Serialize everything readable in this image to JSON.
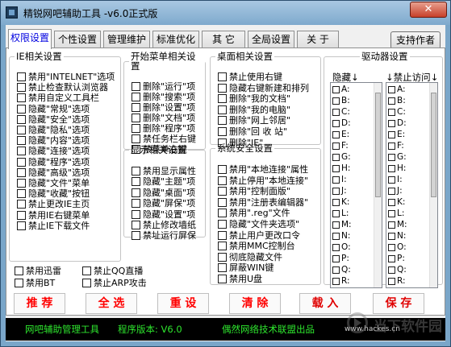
{
  "window": {
    "title": "精锐网吧辅助工具   -v6.0正式版",
    "close_glyph": "✕"
  },
  "tabs": [
    "权限设置",
    "个性设置",
    "管理维护",
    "标准优化",
    "其 它",
    "全局设置",
    "关 于"
  ],
  "support_button": "支持作者",
  "ie_group": {
    "title": "IE相关设置",
    "items": [
      "禁用\"INTELNET\"选项",
      "禁止检查默认浏览器",
      "禁用自定义工具栏",
      "隐藏\"常规\"选项",
      "隐藏\"安全\"选项",
      "隐藏\"隐私\"选项",
      "隐藏\"内容\"选项",
      "隐藏\"连接\"选项",
      "隐藏\"程序\"选项",
      "隐藏\"高级\"选项",
      "隐藏\"文件\"菜单",
      "隐藏\"收藏\"按钮",
      "禁止更改IE主页",
      "禁用IE右键菜单",
      "禁止IE下载文件"
    ]
  },
  "misc_items": [
    "禁用迅雷",
    "禁用BT",
    "禁止QQ直播",
    "禁止ARP攻击"
  ],
  "start_group": {
    "title": "开始菜单相关设置",
    "items": [
      "删除\"运行\"项",
      "删除\"搜索\"项",
      "删除\"设置\"项",
      "删除\"文档\"项",
      "删除\"程序\"项",
      "禁任务栏右键",
      "禁菜单右键"
    ]
  },
  "display_group": {
    "title": "显示相关设置",
    "items": [
      "禁用显示属性",
      "隐藏\"主题\"项",
      "隐藏\"桌面\"项",
      "隐藏\"屏保\"项",
      "隐藏\"设置\"项",
      "禁止修改墙纸",
      "禁址运行屏保"
    ]
  },
  "desktop_group": {
    "title": "桌面相关设置",
    "items": [
      "禁止使用右键",
      "隐藏右键新建和排列",
      "删除\"我的文档\"",
      "删除\"我的电脑\"",
      "删除\"网上邻居\"",
      "删除\"回 收 站\"",
      "删除\"IE\""
    ]
  },
  "security_group": {
    "title": "系统安全设置",
    "items": [
      "禁用\"本地连接\"属性",
      "禁止停用\"本地连接\"",
      "禁用\"控制面版\"",
      "禁用\"注册表编辑器\"",
      "禁用\".reg\"文件",
      "隐藏\"文件夹选项\"",
      "禁止用户更改口令",
      "禁用MMC控制台",
      "彻底隐藏文件",
      "屏蔽WIN键",
      "禁用U盘"
    ]
  },
  "drive_group": {
    "title": "驱动器设置",
    "hide_header": "隐藏",
    "deny_header": "禁止访问",
    "arrow": "↓",
    "hide_drives": [
      "A:",
      "B:",
      "C:",
      "D:",
      "E:",
      "F:",
      "G:",
      "H:",
      "I:",
      "J:",
      "K:",
      "L:",
      "M:",
      "N:",
      "O:",
      "P:",
      "Q:",
      "R:"
    ],
    "deny_drives": [
      "A:",
      "B:",
      "C:",
      "D:",
      "E:",
      "F:",
      "G:",
      "H:",
      "I:",
      "J:",
      "K:",
      "L:",
      "M:",
      "N:",
      "O:",
      "P:",
      "Q:",
      "R:"
    ]
  },
  "actions": [
    "推 荐",
    "全 选",
    "重 设",
    "清 除",
    "载 入",
    "保 存"
  ],
  "status": {
    "left": "网吧辅助管理工具",
    "version_label": "程序版本: V6.0",
    "right": "偶然网络技术联盟出品",
    "url": "www.hackes.cn"
  },
  "watermark": "当下软件园"
}
